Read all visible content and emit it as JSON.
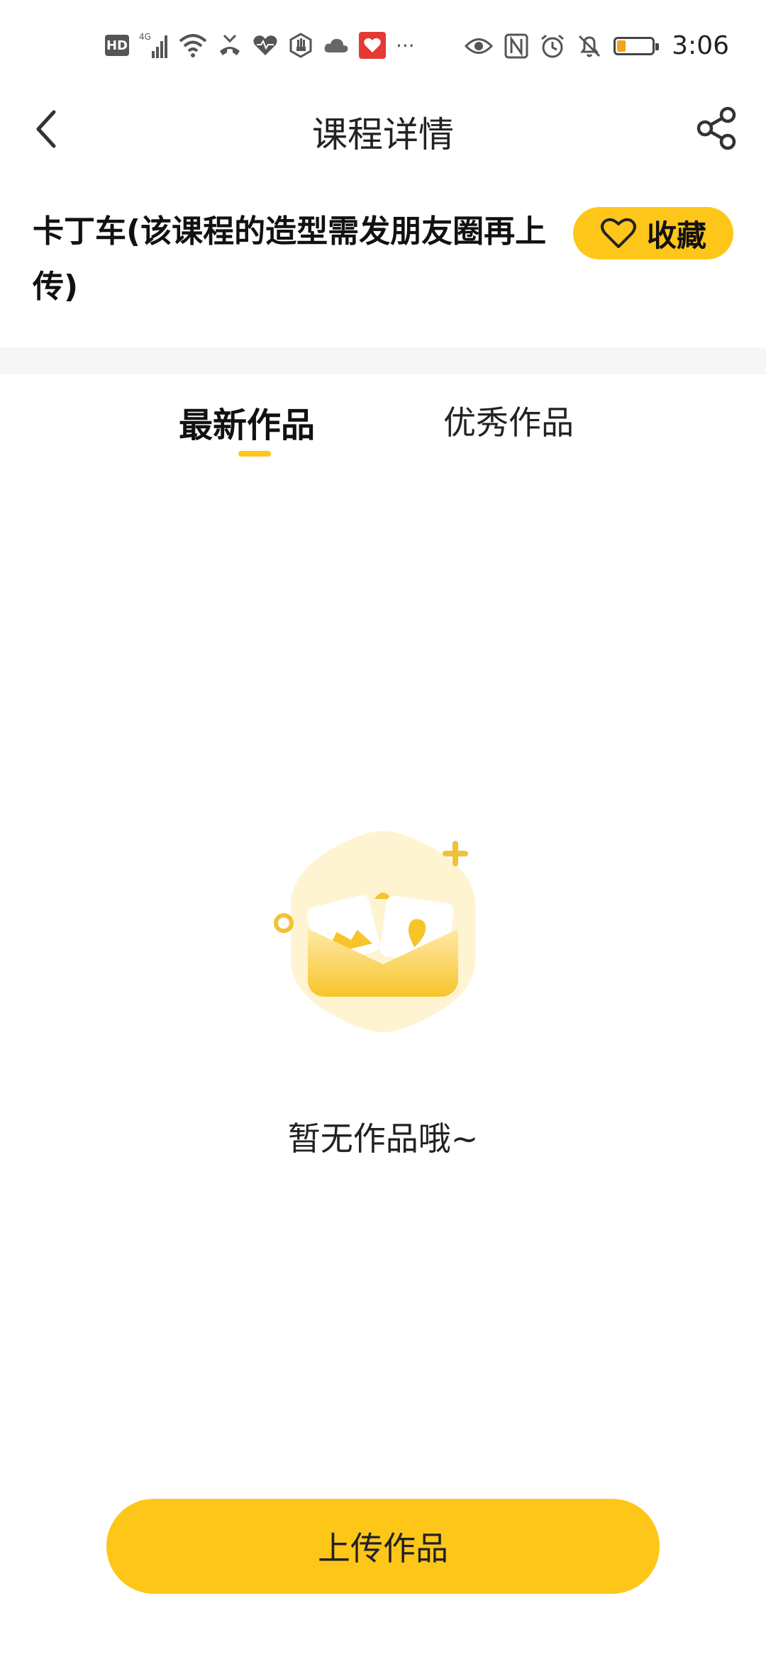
{
  "status_bar": {
    "left_icons": [
      "hd-icon",
      "signal-4g-icon",
      "wifi-icon",
      "missed-call-icon",
      "health-icon",
      "hand-icon",
      "cloud-icon",
      "app-red-icon",
      "more-dots-icon"
    ],
    "hd_label": "HD",
    "network_label": "4G",
    "more_label": "···",
    "right_icons": [
      "eye-icon",
      "nfc-icon",
      "alarm-icon",
      "mute-bell-icon",
      "battery-icon"
    ],
    "time": "3:06",
    "battery_level_fraction": 0.25,
    "battery_color": "#f3a21b"
  },
  "header": {
    "title": "课程详情",
    "back_icon": "chevron-left-icon",
    "share_icon": "share-icon"
  },
  "course": {
    "title": "卡丁车(该课程的造型需发朋友圈再上传)",
    "favorite_label": "收藏",
    "favorite_icon": "heart-outline-icon"
  },
  "tabs": [
    {
      "label": "最新作品",
      "active": true
    },
    {
      "label": "优秀作品",
      "active": false
    }
  ],
  "empty_state": {
    "icon": "empty-folder-images-icon",
    "message": "暂无作品哦~"
  },
  "footer": {
    "upload_label": "上传作品"
  },
  "colors": {
    "accent": "#ffc61a",
    "band": "#f6f6f6",
    "text": "#111111"
  }
}
